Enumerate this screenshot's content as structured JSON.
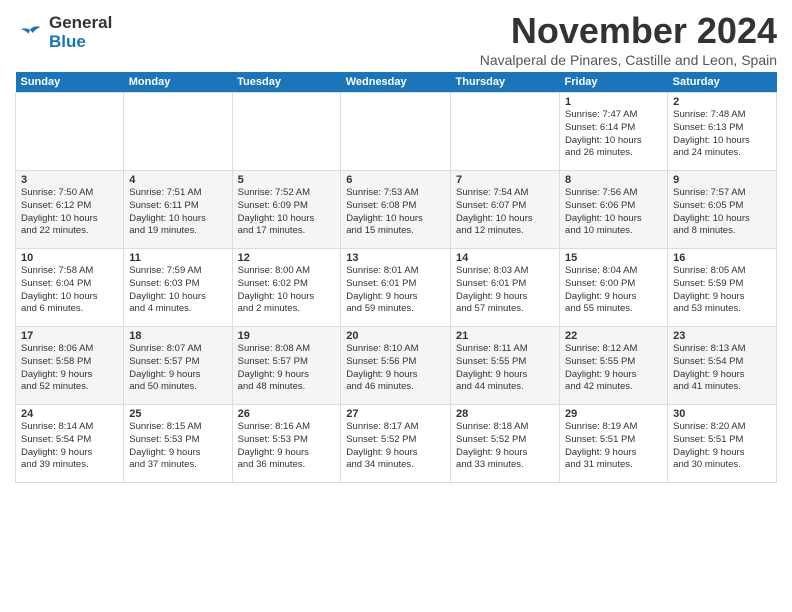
{
  "logo": {
    "line1": "General",
    "line2": "Blue"
  },
  "title": "November 2024",
  "subtitle": "Navalperal de Pinares, Castille and Leon, Spain",
  "days_header": [
    "Sunday",
    "Monday",
    "Tuesday",
    "Wednesday",
    "Thursday",
    "Friday",
    "Saturday"
  ],
  "weeks": [
    [
      {
        "day": "",
        "info": ""
      },
      {
        "day": "",
        "info": ""
      },
      {
        "day": "",
        "info": ""
      },
      {
        "day": "",
        "info": ""
      },
      {
        "day": "",
        "info": ""
      },
      {
        "day": "1",
        "info": "Sunrise: 7:47 AM\nSunset: 6:14 PM\nDaylight: 10 hours\nand 26 minutes."
      },
      {
        "day": "2",
        "info": "Sunrise: 7:48 AM\nSunset: 6:13 PM\nDaylight: 10 hours\nand 24 minutes."
      }
    ],
    [
      {
        "day": "3",
        "info": "Sunrise: 7:50 AM\nSunset: 6:12 PM\nDaylight: 10 hours\nand 22 minutes."
      },
      {
        "day": "4",
        "info": "Sunrise: 7:51 AM\nSunset: 6:11 PM\nDaylight: 10 hours\nand 19 minutes."
      },
      {
        "day": "5",
        "info": "Sunrise: 7:52 AM\nSunset: 6:09 PM\nDaylight: 10 hours\nand 17 minutes."
      },
      {
        "day": "6",
        "info": "Sunrise: 7:53 AM\nSunset: 6:08 PM\nDaylight: 10 hours\nand 15 minutes."
      },
      {
        "day": "7",
        "info": "Sunrise: 7:54 AM\nSunset: 6:07 PM\nDaylight: 10 hours\nand 12 minutes."
      },
      {
        "day": "8",
        "info": "Sunrise: 7:56 AM\nSunset: 6:06 PM\nDaylight: 10 hours\nand 10 minutes."
      },
      {
        "day": "9",
        "info": "Sunrise: 7:57 AM\nSunset: 6:05 PM\nDaylight: 10 hours\nand 8 minutes."
      }
    ],
    [
      {
        "day": "10",
        "info": "Sunrise: 7:58 AM\nSunset: 6:04 PM\nDaylight: 10 hours\nand 6 minutes."
      },
      {
        "day": "11",
        "info": "Sunrise: 7:59 AM\nSunset: 6:03 PM\nDaylight: 10 hours\nand 4 minutes."
      },
      {
        "day": "12",
        "info": "Sunrise: 8:00 AM\nSunset: 6:02 PM\nDaylight: 10 hours\nand 2 minutes."
      },
      {
        "day": "13",
        "info": "Sunrise: 8:01 AM\nSunset: 6:01 PM\nDaylight: 9 hours\nand 59 minutes."
      },
      {
        "day": "14",
        "info": "Sunrise: 8:03 AM\nSunset: 6:01 PM\nDaylight: 9 hours\nand 57 minutes."
      },
      {
        "day": "15",
        "info": "Sunrise: 8:04 AM\nSunset: 6:00 PM\nDaylight: 9 hours\nand 55 minutes."
      },
      {
        "day": "16",
        "info": "Sunrise: 8:05 AM\nSunset: 5:59 PM\nDaylight: 9 hours\nand 53 minutes."
      }
    ],
    [
      {
        "day": "17",
        "info": "Sunrise: 8:06 AM\nSunset: 5:58 PM\nDaylight: 9 hours\nand 52 minutes."
      },
      {
        "day": "18",
        "info": "Sunrise: 8:07 AM\nSunset: 5:57 PM\nDaylight: 9 hours\nand 50 minutes."
      },
      {
        "day": "19",
        "info": "Sunrise: 8:08 AM\nSunset: 5:57 PM\nDaylight: 9 hours\nand 48 minutes."
      },
      {
        "day": "20",
        "info": "Sunrise: 8:10 AM\nSunset: 5:56 PM\nDaylight: 9 hours\nand 46 minutes."
      },
      {
        "day": "21",
        "info": "Sunrise: 8:11 AM\nSunset: 5:55 PM\nDaylight: 9 hours\nand 44 minutes."
      },
      {
        "day": "22",
        "info": "Sunrise: 8:12 AM\nSunset: 5:55 PM\nDaylight: 9 hours\nand 42 minutes."
      },
      {
        "day": "23",
        "info": "Sunrise: 8:13 AM\nSunset: 5:54 PM\nDaylight: 9 hours\nand 41 minutes."
      }
    ],
    [
      {
        "day": "24",
        "info": "Sunrise: 8:14 AM\nSunset: 5:54 PM\nDaylight: 9 hours\nand 39 minutes."
      },
      {
        "day": "25",
        "info": "Sunrise: 8:15 AM\nSunset: 5:53 PM\nDaylight: 9 hours\nand 37 minutes."
      },
      {
        "day": "26",
        "info": "Sunrise: 8:16 AM\nSunset: 5:53 PM\nDaylight: 9 hours\nand 36 minutes."
      },
      {
        "day": "27",
        "info": "Sunrise: 8:17 AM\nSunset: 5:52 PM\nDaylight: 9 hours\nand 34 minutes."
      },
      {
        "day": "28",
        "info": "Sunrise: 8:18 AM\nSunset: 5:52 PM\nDaylight: 9 hours\nand 33 minutes."
      },
      {
        "day": "29",
        "info": "Sunrise: 8:19 AM\nSunset: 5:51 PM\nDaylight: 9 hours\nand 31 minutes."
      },
      {
        "day": "30",
        "info": "Sunrise: 8:20 AM\nSunset: 5:51 PM\nDaylight: 9 hours\nand 30 minutes."
      }
    ]
  ]
}
